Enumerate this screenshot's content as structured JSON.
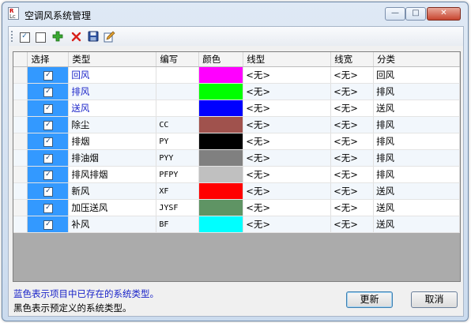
{
  "window": {
    "title": "空调风系统管理",
    "app_icon_top": "R",
    "app_icon_bottom": "Lc",
    "minimize_glyph": "—",
    "maximize_glyph": "□",
    "close_glyph": "✕"
  },
  "toolbar": {
    "check_all_icon": "checkbox-checked-icon",
    "uncheck_all_icon": "checkbox-empty-icon",
    "add_icon": "plus-icon",
    "delete_icon": "x-icon",
    "save_icon": "floppy-disk-icon",
    "edit_icon": "edit-icon"
  },
  "table": {
    "headers": {
      "select": "选择",
      "type": "类型",
      "abbr": "编写",
      "color": "颜色",
      "line_type": "线型",
      "line_width": "线宽",
      "category": "分类"
    },
    "rows": [
      {
        "checked": true,
        "type": "回风",
        "abbr": "",
        "color": "#ff00ff",
        "line_type": "<无>",
        "line_width": "<无>",
        "category": "回风",
        "type_color": "blue"
      },
      {
        "checked": true,
        "type": "排风",
        "abbr": "",
        "color": "#00ff00",
        "line_type": "<无>",
        "line_width": "<无>",
        "category": "排风",
        "type_color": "blue"
      },
      {
        "checked": true,
        "type": "送风",
        "abbr": "",
        "color": "#0000ff",
        "line_type": "<无>",
        "line_width": "<无>",
        "category": "送风",
        "type_color": "blue"
      },
      {
        "checked": true,
        "type": "除尘",
        "abbr": "CC",
        "color": "#a0524d",
        "line_type": "<无>",
        "line_width": "<无>",
        "category": "排风",
        "type_color": "black"
      },
      {
        "checked": true,
        "type": "排烟",
        "abbr": "PY",
        "color": "#000000",
        "line_type": "<无>",
        "line_width": "<无>",
        "category": "排风",
        "type_color": "black"
      },
      {
        "checked": true,
        "type": "排油烟",
        "abbr": "PYY",
        "color": "#808080",
        "line_type": "<无>",
        "line_width": "<无>",
        "category": "排风",
        "type_color": "black"
      },
      {
        "checked": true,
        "type": "排风排烟",
        "abbr": "PFPY",
        "color": "#c0c0c0",
        "line_type": "<无>",
        "line_width": "<无>",
        "category": "排风",
        "type_color": "black"
      },
      {
        "checked": true,
        "type": "新风",
        "abbr": "XF",
        "color": "#ff0000",
        "line_type": "<无>",
        "line_width": "<无>",
        "category": "送风",
        "type_color": "black"
      },
      {
        "checked": true,
        "type": "加压送风",
        "abbr": "JYSF",
        "color": "#5f9464",
        "line_type": "<无>",
        "line_width": "<无>",
        "category": "送风",
        "type_color": "black"
      },
      {
        "checked": true,
        "type": "补风",
        "abbr": "BF",
        "color": "#00ffff",
        "line_type": "<无>",
        "line_width": "<无>",
        "category": "送风",
        "type_color": "black"
      }
    ]
  },
  "notes": {
    "blue_note": "蓝色表示项目中已存在的系统类型。",
    "black_note": "黑色表示预定义的系统类型。"
  },
  "buttons": {
    "update": "更新",
    "cancel": "取消"
  },
  "colors": {
    "selected_cell": "#3399ff",
    "existing_type_text": "#1a23c8"
  }
}
